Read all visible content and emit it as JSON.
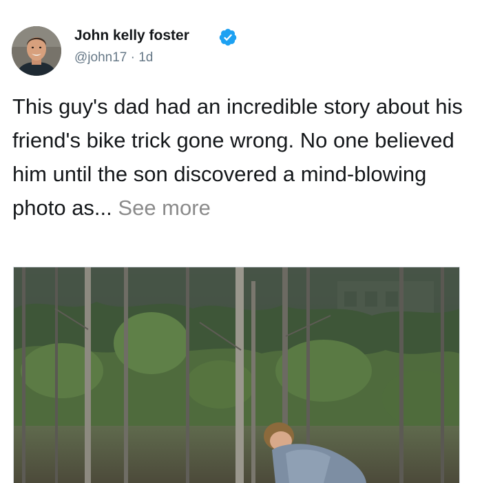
{
  "tweet": {
    "author_name": "John kelly foster",
    "handle": "@john17",
    "separator": "·",
    "timestamp": "1d",
    "text": "This guy's dad had an incredible story about his friend's bike trick gone wrong. No one believed him until the son discovered a mind-blowing photo as...",
    "see_more": "See more",
    "verified": true
  },
  "icons": {
    "verified": "verified-badge-icon"
  },
  "colors": {
    "verified_blue": "#1da1f2",
    "secondary_text": "#657786",
    "see_more_gray": "#8a8a8a",
    "primary_text": "#14171a"
  }
}
